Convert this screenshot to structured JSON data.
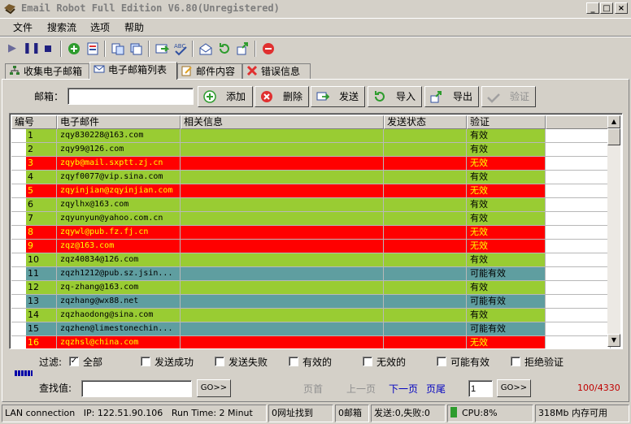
{
  "window": {
    "title": "Email Robot Full Edition V6.80(Unregistered)",
    "min": "_",
    "max": "□",
    "close": "×"
  },
  "menu": [
    "文件",
    "搜索流",
    "选项",
    "帮助"
  ],
  "toolbar": {
    "icons": [
      "play-icon",
      "pause-icon",
      "stop-icon",
      "add-icon",
      "save-icon",
      "copy-icon",
      "copy2-icon",
      "send-icon",
      "spellcheck-icon",
      "open-icon",
      "refresh-icon",
      "export-icon",
      "stop-red-icon"
    ]
  },
  "tabs": [
    {
      "label": "收集电子邮箱",
      "icon": "network-icon"
    },
    {
      "label": "电子邮箱列表",
      "icon": "mail-icon"
    },
    {
      "label": "邮件内容",
      "icon": "edit-icon"
    },
    {
      "label": "错误信息",
      "icon": "error-icon"
    }
  ],
  "email_form": {
    "label": "邮箱：",
    "value": ""
  },
  "buttons": {
    "add": "添加",
    "delete": "删除",
    "send": "发送",
    "import": "导入",
    "export": "导出",
    "verify": "验证"
  },
  "grid": {
    "headers": [
      "编号",
      "电子邮件",
      "相关信息",
      "发送状态",
      "验证"
    ],
    "rows": [
      {
        "no": "1",
        "email": "zqy830228@163.com",
        "info": "",
        "status": "",
        "verify": "有效",
        "state": "valid"
      },
      {
        "no": "2",
        "email": "zqy99@126.com",
        "info": "",
        "status": "",
        "verify": "有效",
        "state": "valid"
      },
      {
        "no": "3",
        "email": "zqyb@mail.sxptt.zj.cn",
        "info": "",
        "status": "",
        "verify": "无效",
        "state": "invalid"
      },
      {
        "no": "4",
        "email": "zqyf0077@vip.sina.com",
        "info": "",
        "status": "",
        "verify": "有效",
        "state": "valid"
      },
      {
        "no": "5",
        "email": "zqyinjian@zqyinjian.com",
        "info": "",
        "status": "",
        "verify": "无效",
        "state": "invalid"
      },
      {
        "no": "6",
        "email": "zqylhx@163.com",
        "info": "",
        "status": "",
        "verify": "有效",
        "state": "valid"
      },
      {
        "no": "7",
        "email": "zqyunyun@yahoo.com.cn",
        "info": "",
        "status": "",
        "verify": "有效",
        "state": "valid"
      },
      {
        "no": "8",
        "email": "zqywl@pub.fz.fj.cn",
        "info": "",
        "status": "",
        "verify": "无效",
        "state": "invalid"
      },
      {
        "no": "9",
        "email": "zqz@163.com",
        "info": "",
        "status": "",
        "verify": "无效",
        "state": "invalid"
      },
      {
        "no": "10",
        "email": "zqz40834@126.com",
        "info": "",
        "status": "",
        "verify": "有效",
        "state": "valid"
      },
      {
        "no": "11",
        "email": "zqzh1212@pub.sz.jsin...",
        "info": "",
        "status": "",
        "verify": "可能有效",
        "state": "maybe"
      },
      {
        "no": "12",
        "email": "zq-zhang@163.com",
        "info": "",
        "status": "",
        "verify": "有效",
        "state": "valid"
      },
      {
        "no": "13",
        "email": "zqzhang@wx88.net",
        "info": "",
        "status": "",
        "verify": "可能有效",
        "state": "maybe"
      },
      {
        "no": "14",
        "email": "zqzhaodong@sina.com",
        "info": "",
        "status": "",
        "verify": "有效",
        "state": "valid"
      },
      {
        "no": "15",
        "email": "zqzhen@limestonechin...",
        "info": "",
        "status": "",
        "verify": "可能有效",
        "state": "maybe"
      },
      {
        "no": "16",
        "email": "zqzhsl@china.com",
        "info": "",
        "status": "",
        "verify": "无效",
        "state": "invalid"
      }
    ]
  },
  "colors": {
    "valid": "#99cc33",
    "invalid": "#ff0000",
    "maybe": "#5f9ea0"
  },
  "filter": {
    "label": "过滤:",
    "options": [
      {
        "label": "全部",
        "checked": true
      },
      {
        "label": "发送成功",
        "checked": false
      },
      {
        "label": "发送失败",
        "checked": false
      },
      {
        "label": "有效的",
        "checked": false
      },
      {
        "label": "无效的",
        "checked": false
      },
      {
        "label": "可能有效",
        "checked": false
      },
      {
        "label": "拒绝验证",
        "checked": false
      }
    ]
  },
  "progress": {
    "value": 0.03
  },
  "search": {
    "label": "查找值:",
    "value": "",
    "go": "GO>>",
    "first": "页首",
    "prev": "上一页",
    "next": "下一页",
    "last": "页尾",
    "page": "1",
    "go2": "GO>>",
    "count": "100/4330"
  },
  "statusbar": {
    "lan": "LAN connection",
    "ip": "IP: 122.51.90.106",
    "runtime": "Run Time: 2 Minut",
    "found": "0网址找到",
    "mailboxes": "0邮箱",
    "sent": "发送:0,失败:0",
    "cpu": "CPU:8%",
    "mem": "318Mb 内存可用"
  }
}
